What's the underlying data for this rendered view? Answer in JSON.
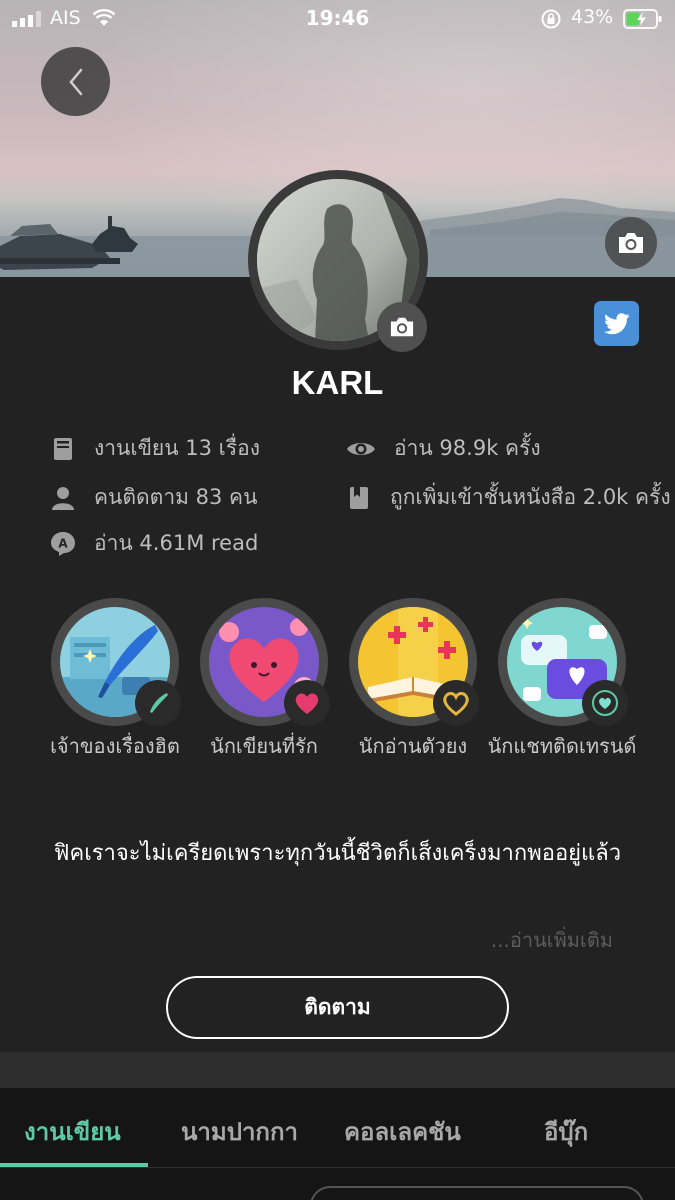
{
  "status_bar": {
    "carrier": "AIS",
    "time": "19:46",
    "battery": "43%"
  },
  "profile": {
    "name": "KARL"
  },
  "stats": [
    {
      "icon": "book-icon",
      "text": "งานเขียน 13 เรื่อง"
    },
    {
      "icon": "eye-icon",
      "text": "อ่าน 98.9k ครั้ง"
    },
    {
      "icon": "person-icon",
      "text": "คนติดตาม 83 คน"
    },
    {
      "icon": "bookmark-book-icon",
      "text": "ถูกเพิ่มเข้าชั้นหนังสือ 2.0k ครั้ง"
    },
    {
      "icon": "read-a-icon",
      "text": "อ่าน 4.61M read"
    }
  ],
  "badges": [
    {
      "name": "quill-badge",
      "label": "เจ้าของเรื่องฮิต"
    },
    {
      "name": "heart-badge",
      "label": "นักเขียนที่รัก"
    },
    {
      "name": "book-badge",
      "label": "นักอ่านตัวยง"
    },
    {
      "name": "chat-badge",
      "label": "นักแชทติดเทรนด์"
    }
  ],
  "bio": "ฟิคเราจะไม่เครียดเพราะทุกวันนี้ชีวิตก็เส็งเคร็งมากพออยู่แล้ว",
  "read_more": "...อ่านเพิ่มเติม",
  "follow_label": "ติดตาม",
  "tabs": [
    {
      "label": "งานเขียน",
      "active": true
    },
    {
      "label": "นามปากกา",
      "active": false
    },
    {
      "label": "คอลเลคชัน",
      "active": false
    },
    {
      "label": "อีบุ๊ก",
      "active": false
    }
  ],
  "colors": {
    "accent": "#5fc9a6",
    "background": "#222222",
    "twitter": "#4a90d9"
  }
}
